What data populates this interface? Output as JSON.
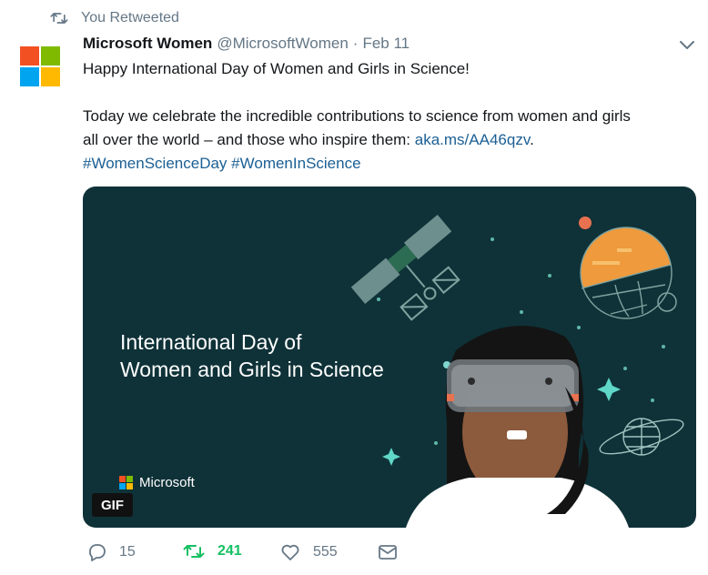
{
  "retweet_context": {
    "icon": "retweet-icon",
    "label": "You Retweeted"
  },
  "tweet": {
    "author": {
      "name": "Microsoft Women",
      "handle": "@MicrosoftWomen"
    },
    "separator": "·",
    "date": "Feb 11",
    "line1": "Happy International Day of Women and Girls in Science!",
    "line2": "Today we celebrate the incredible contributions to science from women and girls",
    "line3_text": "all over the world – and those who inspire them: ",
    "line3_link": "aka.ms/AA46qzv",
    "line3_end": ".",
    "hashtags": [
      "#WomenScienceDay",
      "#WomenInScience"
    ]
  },
  "media": {
    "title_line1": "International Day of",
    "title_line2": "Women and Girls in Science",
    "brand": "Microsoft",
    "badge": "GIF"
  },
  "actions": {
    "reply_count": "15",
    "retweet_count": "241",
    "like_count": "555"
  },
  "colors": {
    "link": "#1b5f94",
    "retweeted_green": "#17bf63",
    "muted": "#657786",
    "media_bg": "#0f3238"
  }
}
